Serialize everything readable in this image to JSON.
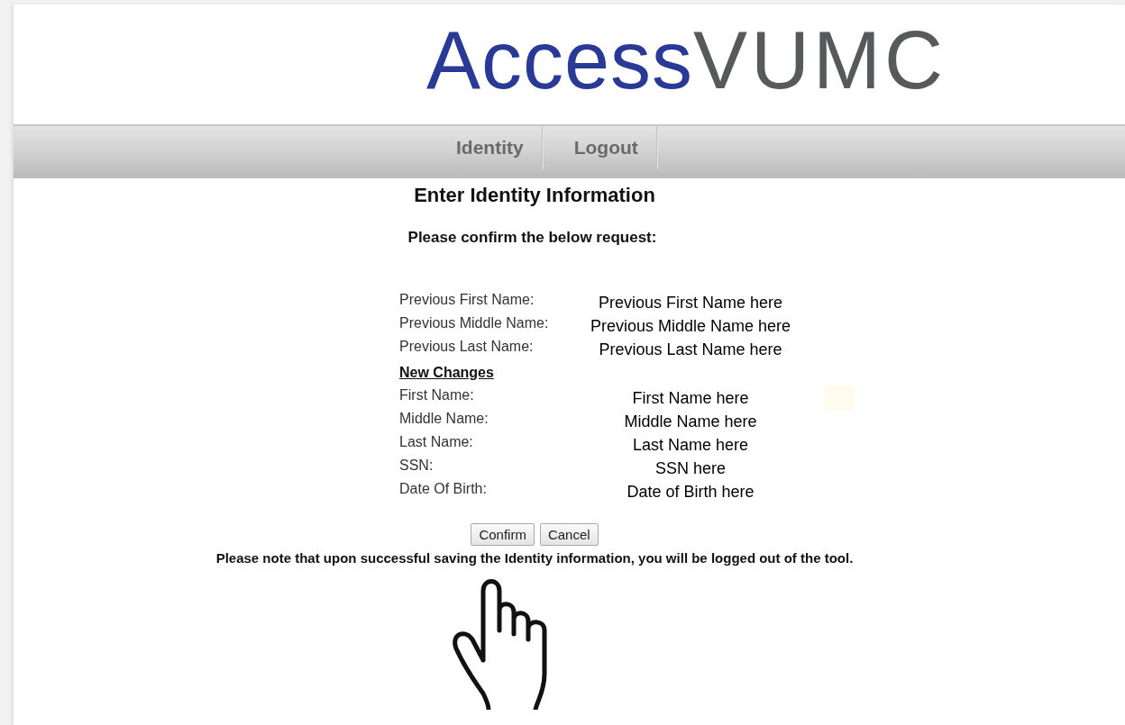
{
  "logo": {
    "part_1": "Access",
    "part_2": "VUMC"
  },
  "nav": [
    {
      "label": "Identity"
    },
    {
      "label": "Logout"
    }
  ],
  "title": "Enter Identity Information",
  "subtitle": "Please confirm the below request:",
  "previous": [
    {
      "label": "Previous First Name:",
      "value": "Previous First Name here"
    },
    {
      "label": "Previous Middle Name:",
      "value": "Previous Middle Name here"
    },
    {
      "label": "Previous Last Name:",
      "value": "Previous Last Name here"
    }
  ],
  "section_heading": "New Changes",
  "changes": [
    {
      "label": "First Name:",
      "value": "First Name here"
    },
    {
      "label": "Middle Name:",
      "value": "Middle Name here"
    },
    {
      "label": "Last Name:",
      "value": "Last Name here"
    },
    {
      "label": "SSN:",
      "value": "SSN here"
    },
    {
      "label": "Date Of Birth:",
      "value": "Date of Birth here"
    }
  ],
  "buttons": [
    "Confirm",
    "Cancel"
  ],
  "note": "Please note that upon successful saving the Identity information, you will be logged out of the tool."
}
